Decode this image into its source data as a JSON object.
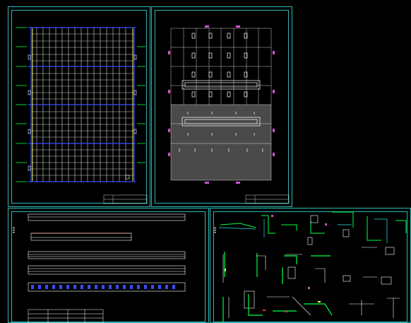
{
  "viewer": {
    "background": "#000000",
    "frame_color": "#2fb8b8"
  },
  "sheets": [
    {
      "id": "floor-plan",
      "label": "",
      "accent": "#3a4bff"
    },
    {
      "id": "roof-plan",
      "label": "",
      "accent": "#555555"
    },
    {
      "id": "elevations",
      "label": "",
      "accent": "#3a4bff"
    },
    {
      "id": "details",
      "label": "",
      "accent": "#00ff44"
    }
  ],
  "colors": {
    "grid": "#ffffff",
    "blue": "#3a4bff",
    "green": "#00ff44",
    "yellow": "#ffff66",
    "magenta": "#d050d0",
    "red": "#ff3030",
    "cyan": "#30e0e0",
    "gray": "#555555"
  }
}
